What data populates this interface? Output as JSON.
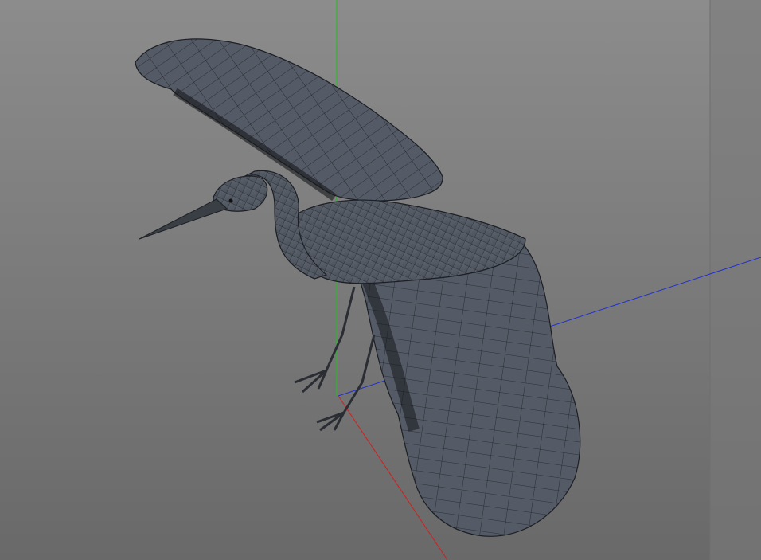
{
  "viewport": {
    "type": "3d-perspective-viewport",
    "object": "heron-wireframe-model",
    "colors": {
      "background_top": "#8c8c8c",
      "background_bottom": "#696969",
      "side_panel": "#7a7a7a",
      "mesh_fill": "#555b66",
      "mesh_wire": "#1c1f24",
      "axis_x": "#d02020",
      "axis_y": "#20c020",
      "axis_z": "#2030d0"
    }
  }
}
